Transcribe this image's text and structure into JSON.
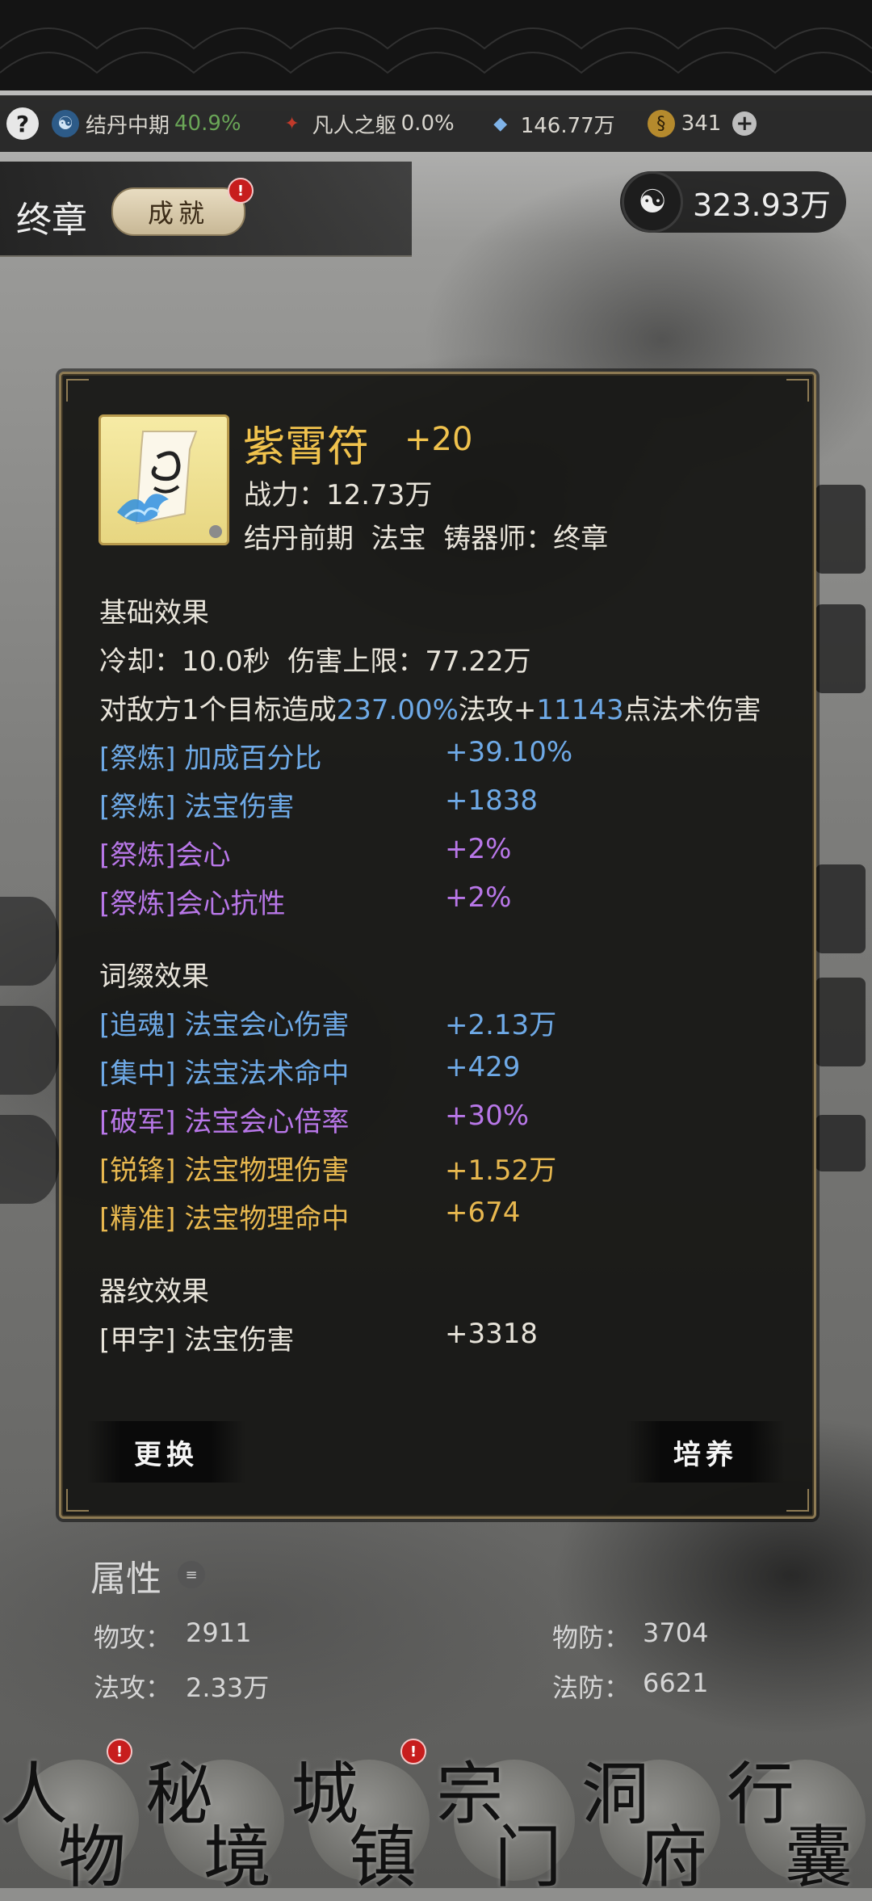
{
  "status": {
    "help": "?",
    "realm_name": "结丹中期",
    "realm_pct": "40.9%",
    "body_name": "凡人之躯",
    "body_pct": "0.0%",
    "crystal": "146.77万",
    "gold": "341",
    "plus": "+"
  },
  "header": {
    "chapter": "终章",
    "achievement_btn": "成就",
    "badge": "!",
    "spirit_stones": "323.93万"
  },
  "item": {
    "name": "紫霄符",
    "plus": "+20",
    "power_label": "战力：",
    "power_value": "12.73万",
    "realm": "结丹前期",
    "type": "法宝",
    "maker_label": "铸器师：",
    "maker": "终章"
  },
  "basic": {
    "title": "基础效果",
    "cooldown_label": "冷却：",
    "cooldown": "10.0秒",
    "cap_label": "伤害上限：",
    "cap": "77.22万",
    "desc_pre": "对敌方1个目标造成",
    "desc_pct": "237.00%",
    "desc_mid": "法攻+",
    "desc_num": "11143",
    "desc_post": "点法术伤害",
    "stats": [
      {
        "key": "[祭炼] 加成百分比",
        "value": "+39.10%"
      },
      {
        "key": "[祭炼] 法宝伤害",
        "value": "+1838"
      },
      {
        "key": "[祭炼]会心",
        "value": "+2%"
      },
      {
        "key": "[祭炼]会心抗性",
        "value": "+2%"
      }
    ]
  },
  "affix": {
    "title": "词缀效果",
    "stats": [
      {
        "key": "[追魂] 法宝会心伤害",
        "value": "+2.13万"
      },
      {
        "key": "[集中] 法宝法术命中",
        "value": "+429"
      },
      {
        "key": "[破军] 法宝会心倍率",
        "value": "+30%"
      },
      {
        "key": "[锐锋] 法宝物理伤害",
        "value": "+1.52万"
      },
      {
        "key": "[精准] 法宝物理命中",
        "value": "+674"
      }
    ]
  },
  "pattern": {
    "title": "器纹效果",
    "stats": [
      {
        "key": "[甲字] 法宝伤害",
        "value": "+3318"
      }
    ]
  },
  "buttons": {
    "replace": "更换",
    "cultivate": "培养"
  },
  "attributes": {
    "title": "属性",
    "phys_atk_label": "物攻：",
    "phys_atk": "2911",
    "phys_def_label": "物防：",
    "phys_def": "3704",
    "mag_atk_label": "法攻：",
    "mag_atk": "2.33万",
    "mag_def_label": "法防：",
    "mag_def": "6621"
  },
  "nav": [
    {
      "c1": "人",
      "c2": "物"
    },
    {
      "c1": "秘",
      "c2": "境"
    },
    {
      "c1": "城",
      "c2": "镇"
    },
    {
      "c1": "宗",
      "c2": "门"
    },
    {
      "c1": "洞",
      "c2": "府"
    },
    {
      "c1": "行",
      "c2": "囊"
    }
  ],
  "colors": {
    "gold_title": "#f0c24d",
    "blue_stat": "#6ea9e6",
    "purple_stat": "#b877e8",
    "gold_stat": "#e8b84f",
    "realm_green": "#6aa657"
  }
}
